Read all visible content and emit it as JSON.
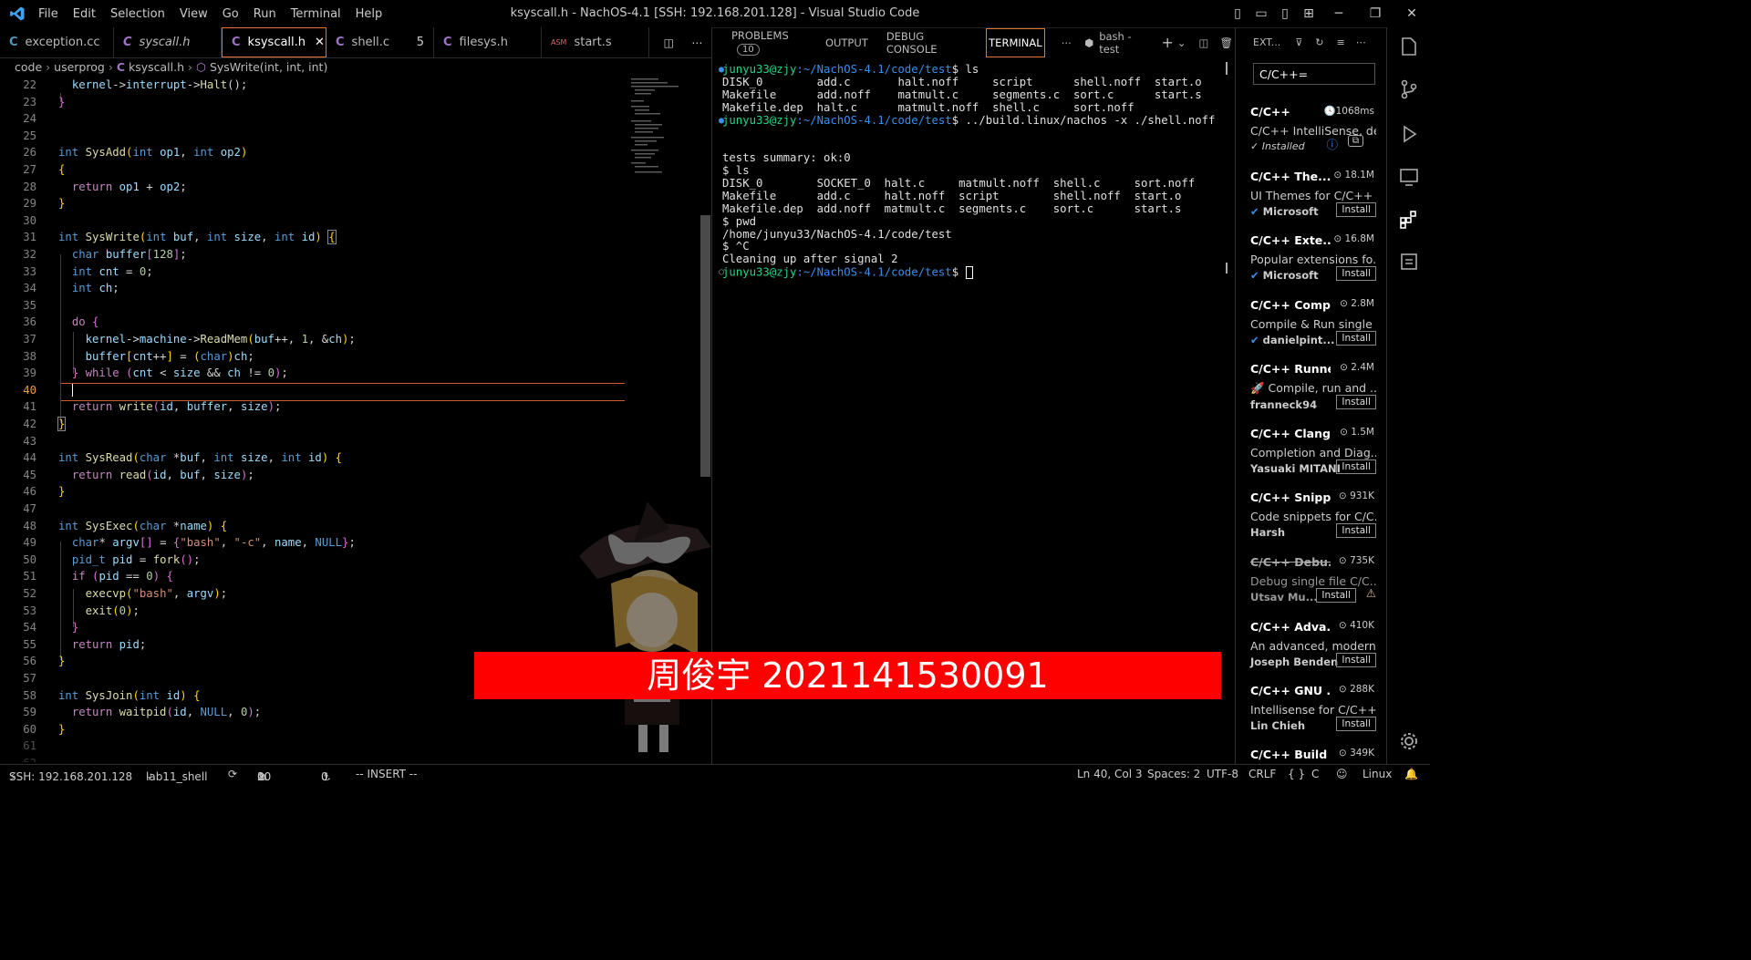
{
  "window": {
    "title": "ksyscall.h - NachOS-4.1 [SSH: 192.168.201.128] - Visual Studio Code",
    "menu": [
      "File",
      "Edit",
      "Selection",
      "View",
      "Go",
      "Run",
      "Terminal",
      "Help"
    ]
  },
  "editor": {
    "tabs": [
      {
        "label": "exception.cc",
        "icon": "cpp-file-icon"
      },
      {
        "label": "syscall.h",
        "icon": "c-file-icon",
        "italic": true
      },
      {
        "label": "ksyscall.h",
        "icon": "c-file-icon",
        "active": true
      },
      {
        "label": "shell.c",
        "icon": "c-file-icon",
        "count": "5"
      },
      {
        "label": "filesys.h",
        "icon": "c-file-icon"
      },
      {
        "label": "start.s",
        "icon": "asm-file-icon",
        "badge": "ASM"
      }
    ],
    "breadcrumb": [
      "code",
      "userprog",
      "ksyscall.h",
      "SysWrite(int, int, int)"
    ],
    "banner": "周俊宇 2021141530091",
    "current_line": 40
  },
  "panel": {
    "tabs": [
      "PROBLEMS",
      "OUTPUT",
      "DEBUG CONSOLE",
      "TERMINAL"
    ],
    "problems_count": "10",
    "active_tab": "TERMINAL",
    "shell_label": "bash - test",
    "terminal": {
      "prompt_user": "junyu33@zjy",
      "prompt_path": ":~/NachOS-4.1/code/test",
      "cmd1": " ls",
      "ls1": [
        "DISK_0        add.c       halt.noff     script      shell.noff  start.o",
        "Makefile      add.noff    matmult.c     segments.c  sort.c      start.s",
        "Makefile.dep  halt.c      matmult.noff  shell.c     sort.noff"
      ],
      "cmd2": " ../build.linux/nachos -x ./shell.noff",
      "output": [
        "",
        "",
        "tests summary: ok:0",
        "$ ls",
        "DISK_0        SOCKET_0  halt.c     matmult.noff  shell.c     sort.noff",
        "Makefile      add.c     halt.noff  script        shell.noff  start.o",
        "Makefile.dep  add.noff  matmult.c  segments.c    sort.c      start.s",
        "$ pwd",
        "/home/junyu33/NachOS-4.1/code/test",
        "$ ^C",
        "Cleaning up after signal 2"
      ]
    }
  },
  "extensions": {
    "header": "EXT...",
    "search": "C/C++=",
    "items": [
      {
        "name": "C/C++",
        "downloads": "1068ms",
        "desc": "C/C++ IntelliSense, de...",
        "publisher": "✓ Installed",
        "install": ""
      },
      {
        "name": "C/C++ The...",
        "downloads": "18.1M",
        "desc": "UI Themes for C/C++ ...",
        "publisher": "Microsoft",
        "install": "Install"
      },
      {
        "name": "C/C++ Exte...",
        "downloads": "16.8M",
        "desc": "Popular extensions fo...",
        "publisher": "Microsoft",
        "install": "Install"
      },
      {
        "name": "C/C++ Comp...",
        "downloads": "2.8M",
        "desc": "Compile & Run single ...",
        "publisher": "danielpint...",
        "install": "Install"
      },
      {
        "name": "C/C++ Runner",
        "downloads": "2.4M",
        "desc": "🚀 Compile, run and ...",
        "publisher": "franneck94",
        "install": "Install"
      },
      {
        "name": "C/C++ Clang...",
        "downloads": "1.5M",
        "desc": "Completion and Diag...",
        "publisher": "Yasuaki MITANI",
        "install": "Install"
      },
      {
        "name": "C/C++ Snipp...",
        "downloads": "931K",
        "desc": "Code snippets for C/C...",
        "publisher": "Harsh",
        "install": "Install"
      },
      {
        "name": "C/C++ Debu...",
        "downloads": "735K",
        "desc": "Debug single file C/C...",
        "publisher": "Utsav Mu...",
        "install": "Install"
      },
      {
        "name": "C/C++ Adva...",
        "downloads": "410K",
        "desc": "An advanced, modern...",
        "publisher": "Joseph Benden",
        "install": "Install"
      },
      {
        "name": "C/C++ GNU ...",
        "downloads": "288K",
        "desc": "Intellisense for C/C++...",
        "publisher": "Lin Chieh",
        "install": "Install"
      },
      {
        "name": "C/C++ Build ...",
        "downloads": "349K",
        "desc": "",
        "publisher": "",
        "install": ""
      }
    ]
  },
  "status": {
    "remote": "SSH: 192.168.201.128",
    "branch": "lab11_shell",
    "errors": "10",
    "warnings": "0",
    "ports": "0",
    "mode": "-- INSERT --",
    "position": "Ln 40, Col 3",
    "spaces": "Spaces: 2",
    "encoding": "UTF-8",
    "eol": "CRLF",
    "language": "Linux"
  },
  "colors": {
    "accent": "#e0752d",
    "banner": "#ff0000",
    "prompt_user": "#23d18b",
    "prompt_path": "#3b8eea"
  }
}
